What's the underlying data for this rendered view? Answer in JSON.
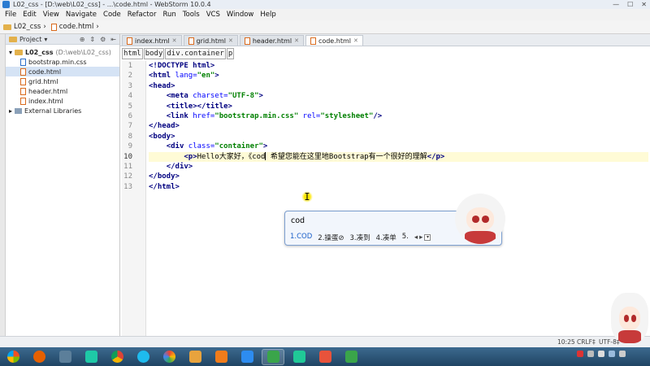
{
  "window": {
    "title": "L02_css - [D:\\web\\L02_css] - ...\\code.html - WebStorm 10.0.4"
  },
  "menu": [
    "File",
    "Edit",
    "View",
    "Navigate",
    "Code",
    "Refactor",
    "Run",
    "Tools",
    "VCS",
    "Window",
    "Help"
  ],
  "navbar": {
    "project": "L02_css",
    "file": "code.html"
  },
  "project_panel": {
    "header": "Project",
    "root": {
      "name": "L02_css",
      "path": "(D:\\web\\L02_css)"
    },
    "files": [
      "bootstrap.min.css",
      "code.html",
      "grid.html",
      "header.html",
      "index.html"
    ],
    "external": "External Libraries"
  },
  "tabs": [
    "index.html",
    "grid.html",
    "header.html",
    "code.html"
  ],
  "editor_crumbs": [
    "html",
    "body",
    "div.container",
    "p"
  ],
  "line_numbers": [
    "1",
    "2",
    "3",
    "4",
    "5",
    "6",
    "7",
    "8",
    "9",
    "10",
    "11",
    "12",
    "13"
  ],
  "code": {
    "l1": "<!DOCTYPE html>",
    "l2_tag": "<html ",
    "l2_attr": "lang=",
    "l2_val": "\"en\"",
    "l2_end": ">",
    "l3": "<head>",
    "l4_tag": "<meta ",
    "l4_attr": "charset=",
    "l4_val": "\"UTF-8\"",
    "l4_end": ">",
    "l5": "<title></title>",
    "l6_tag": "<link ",
    "l6_attr1": "href=",
    "l6_val1": "\"bootstrap.min.css\"",
    "l6_attr2": " rel=",
    "l6_val2": "\"stylesheet\"",
    "l6_end": "/>",
    "l7": "</head>",
    "l8": "<body>",
    "l9_tag": "<div ",
    "l9_attr": "class=",
    "l9_val": "\"container\"",
    "l9_end": ">",
    "l10_open": "<p>",
    "l10_text_a": "Hello大家好，《cod",
    "l10_text_b": " 希望您能在这里地Bootstrap有一个很好的理解",
    "l10_close": "</p>",
    "l11": "</div>",
    "l12": "</body>",
    "l13": "</html>"
  },
  "ime": {
    "composition": "cod",
    "candidates": [
      "1.COD",
      "2.操蛋⊘",
      "3.凑到",
      "4.凑单",
      "5."
    ],
    "pager_prev": "◂",
    "pager_next": "▸"
  },
  "status": {
    "position": "10:25",
    "line_ending": "CRLF‡",
    "encoding": "UTF-8‡"
  },
  "taskbar_icons": [
    "windows-start-icon",
    "firefox-icon",
    "app-icon",
    "webstorm-icon",
    "chrome-icon",
    "ie-icon",
    "picasa-icon",
    "feather-icon",
    "media-icon",
    "blue-app-icon",
    "camtasia-icon",
    "webstorm2-icon",
    "slides-icon",
    "camtasia2-icon"
  ],
  "colors": {
    "accent": "#2b7bd1",
    "tag": "#000080",
    "attr": "#0000ff",
    "value": "#008000",
    "current_line": "#fffbd6"
  }
}
